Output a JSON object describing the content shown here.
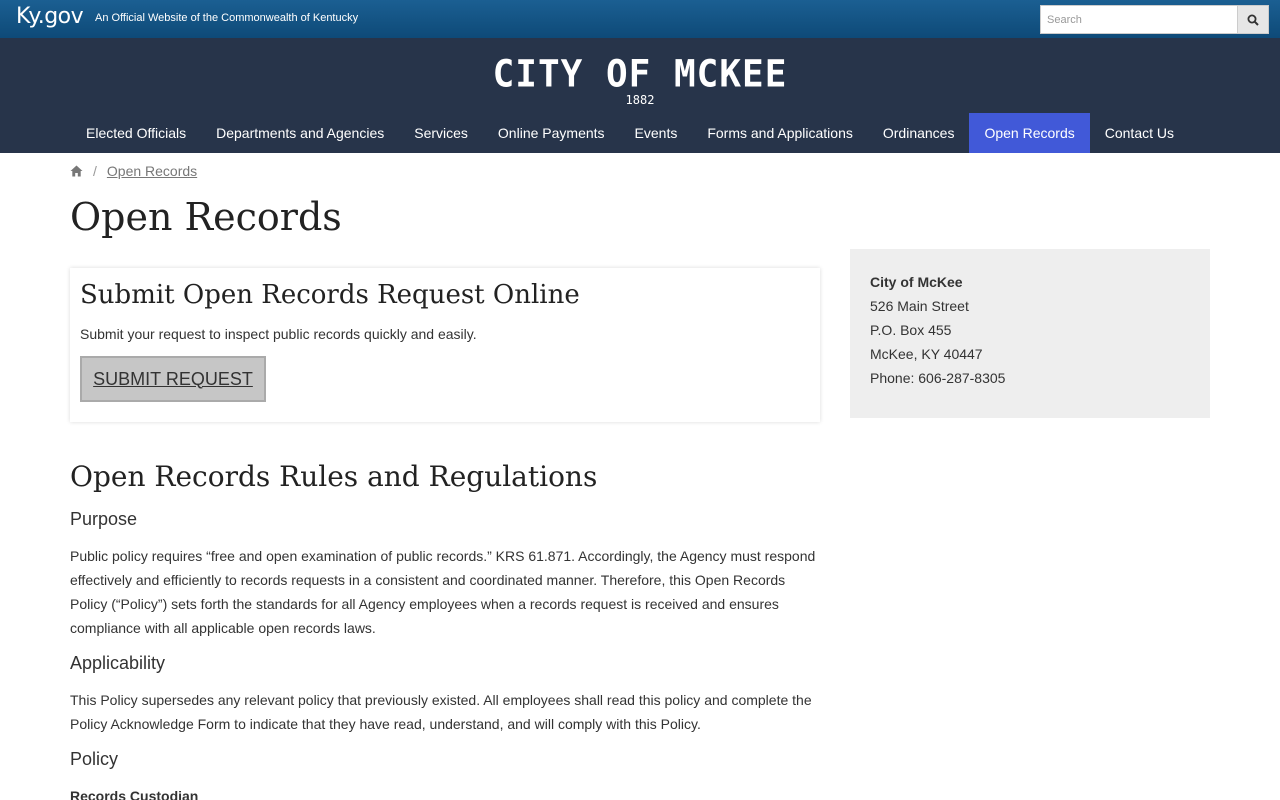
{
  "kybar": {
    "logo": "Ky.gov",
    "tagline": "An Official Website of the Commonwealth of Kentucky",
    "search_placeholder": "Search",
    "search_icon": "search-icon"
  },
  "header": {
    "site_title": "CITY OF MCKEE",
    "year": "1882",
    "nav": [
      {
        "label": "Elected Officials"
      },
      {
        "label": "Departments and Agencies"
      },
      {
        "label": "Services"
      },
      {
        "label": "Online Payments"
      },
      {
        "label": "Events"
      },
      {
        "label": "Forms and Applications"
      },
      {
        "label": "Ordinances"
      },
      {
        "label": "Open Records",
        "active": true
      },
      {
        "label": "Contact Us"
      }
    ],
    "active_color": "#4159d8",
    "bg_color": "#27344a"
  },
  "breadcrumb": {
    "home_icon": "home-icon",
    "separator": "/",
    "current": "Open Records"
  },
  "page_title": "Open Records",
  "request_card": {
    "title": "Submit Open Records Request Online",
    "text": "Submit your request to inspect public records quickly and easily.",
    "button_label": "SUBMIT REQUEST"
  },
  "sidebar": {
    "name": "City of McKee",
    "address1": "526 Main Street",
    "address2": "P.O. Box 455",
    "city": "McKee, KY 40447",
    "phone": "Phone: 606-287-8305"
  },
  "rules": {
    "heading": "Open Records Rules and Regulations",
    "purpose_heading": "Purpose",
    "purpose_text": "Public policy requires “free and open examination of public records.” KRS 61.871. Accordingly, the Agency must respond effectively and efficiently to records requests in a consistent and coordinated manner. Therefore, this Open Records Policy (“Policy”) sets forth the standards for all Agency employees when a records request is received and ensures compliance with all applicable open records laws.",
    "applicability_heading": "Applicability",
    "applicability_text": "This Policy supersedes any relevant policy that previously existed. All employees shall read this policy and complete the Policy Acknowledge Form to indicate that they have read, understand, and will comply with this Policy.",
    "policy_heading": "Policy",
    "custodian_label": "Records Custodian"
  }
}
